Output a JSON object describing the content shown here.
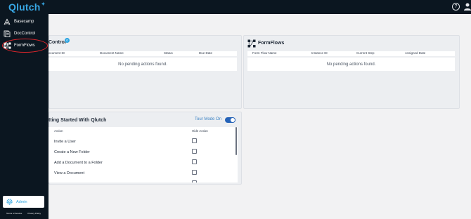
{
  "app": {
    "logo_text": "Qlutch",
    "help_symbol": "?"
  },
  "sidebar": {
    "items": [
      {
        "label": "Basecamp",
        "icon": "mountain-icon"
      },
      {
        "label": "DocControl",
        "icon": "documents-icon"
      },
      {
        "label": "FormFlows",
        "icon": "workflow-icon",
        "locked": true
      }
    ],
    "admin_label": "Admin",
    "footer": {
      "terms": "Terms of Service",
      "privacy": "Privacy Policy"
    }
  },
  "doc_control": {
    "title": "Control",
    "badge": "0",
    "columns": [
      "ocument ID",
      "Document Name",
      "Status",
      "Due Date"
    ],
    "empty_message": "No pending actions found."
  },
  "form_flows": {
    "title": "FormFlows",
    "columns": [
      "Form Flow Name",
      "Instance ID",
      "Current Step",
      "Assigned Date"
    ],
    "empty_message": "No pending actions found."
  },
  "getting_started": {
    "title": "tting Started With Qlutch",
    "tour_label": "Tour Mode On",
    "tour_on": true,
    "columns": {
      "action": "Action",
      "hide": "Hide Action"
    },
    "rows": [
      {
        "label": "Invite a User",
        "hidden": false
      },
      {
        "label": "Create a New Folder",
        "hidden": false
      },
      {
        "label": "Add a Document to a Folder",
        "hidden": false
      },
      {
        "label": "View a Document",
        "hidden": false
      },
      {
        "label": "",
        "hidden": false
      }
    ]
  },
  "colors": {
    "sidebar_bg": "#0b1620",
    "accent": "#2aa3e0",
    "highlight_ring": "#e0262b",
    "toggle_on": "#2563b8"
  }
}
